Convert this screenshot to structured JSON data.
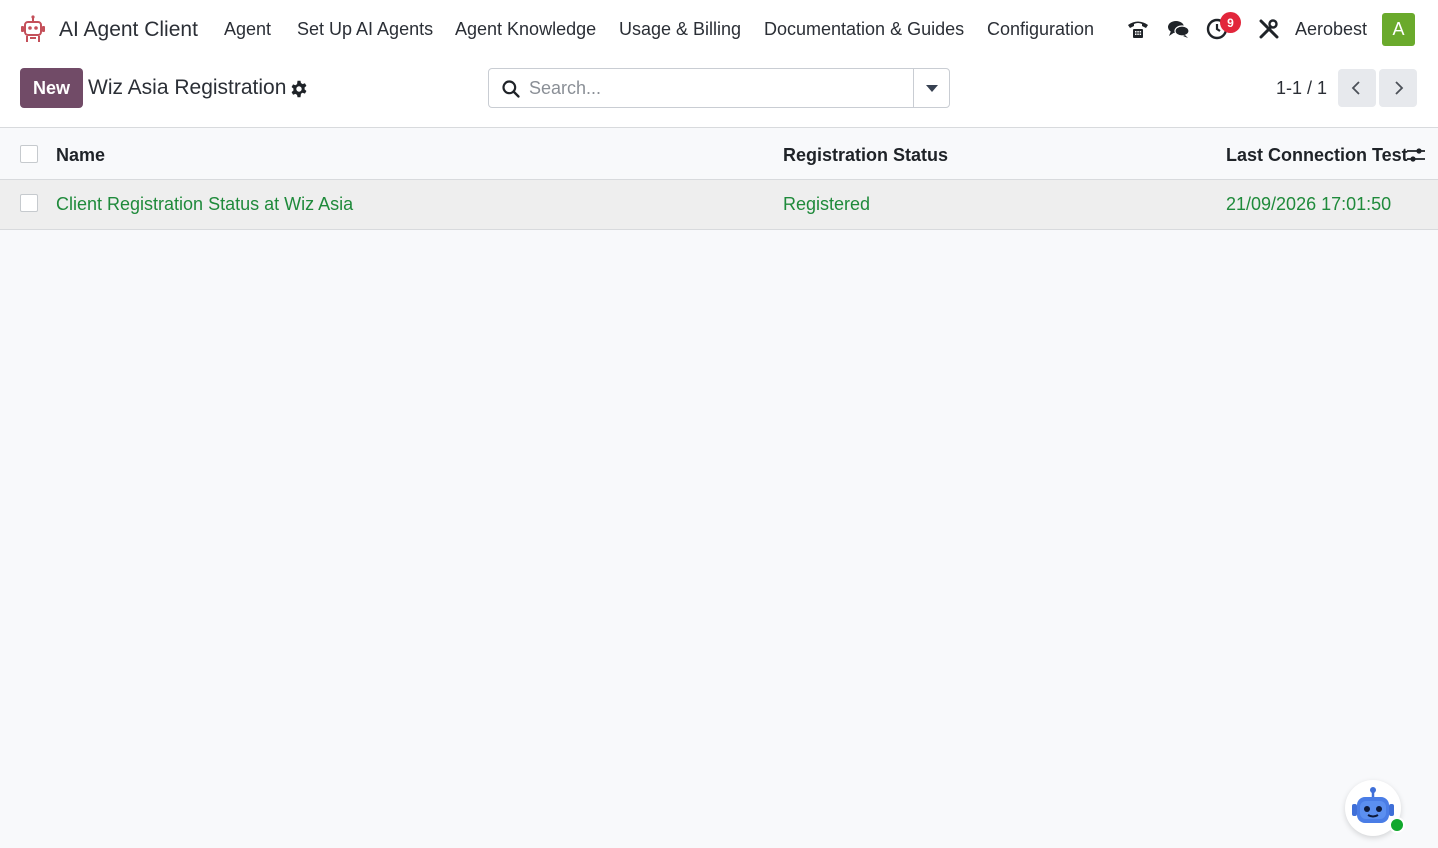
{
  "navbar": {
    "app_title": "AI Agent Client",
    "menu": [
      {
        "label": "Agent"
      },
      {
        "label": "Set Up AI Agents"
      },
      {
        "label": "Agent Knowledge"
      },
      {
        "label": "Usage & Billing"
      },
      {
        "label": "Documentation & Guides"
      },
      {
        "label": "Configuration"
      }
    ],
    "activity_count": "9",
    "company": "Aerobest",
    "avatar_letter": "A",
    "icons": [
      "phone-icon",
      "chat-icon",
      "clock-icon",
      "tools-icon"
    ]
  },
  "control_panel": {
    "new_label": "New",
    "title": "Wiz Asia Registration",
    "search_placeholder": "Search...",
    "search_value": "",
    "pager": "1-1 / 1"
  },
  "list": {
    "columns": [
      "Name",
      "Registration Status",
      "Last Connection Test"
    ],
    "rows": [
      {
        "name": "Client Registration Status at Wiz Asia",
        "status": "Registered",
        "last_test": "21/09/2026 17:01:50"
      }
    ]
  },
  "colors": {
    "accent": "#714b67",
    "row_text": "#1f8a3b",
    "avatar_bg": "#6aaa2c",
    "badge": "#e2263b"
  }
}
